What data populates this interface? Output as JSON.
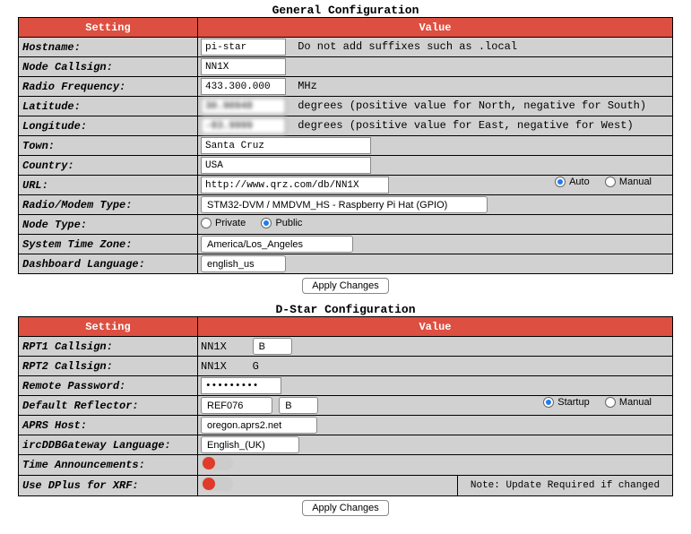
{
  "general": {
    "title": "General Configuration",
    "headers": {
      "setting": "Setting",
      "value": "Value"
    },
    "hostname": {
      "label": "Hostname:",
      "value": "pi-star",
      "hint": "Do not add suffixes such as .local"
    },
    "callsign": {
      "label": "Node Callsign:",
      "value": "NN1X"
    },
    "radiofreq": {
      "label": "Radio Frequency:",
      "value": "433.300.000",
      "hint": "MHz"
    },
    "latitude": {
      "label": "Latitude:",
      "value": "30.90948",
      "hint": "degrees (positive value for North, negative for South)"
    },
    "longitude": {
      "label": "Longitude:",
      "value": "-83.9999",
      "hint": "degrees (positive value for East, negative for West)"
    },
    "town": {
      "label": "Town:",
      "value": "Santa Cruz"
    },
    "country": {
      "label": "Country:",
      "value": "USA"
    },
    "url": {
      "label": "URL:",
      "value": "http://www.qrz.com/db/NN1X",
      "opts": {
        "auto": "Auto",
        "manual": "Manual",
        "selected": "auto"
      }
    },
    "modem": {
      "label": "Radio/Modem Type:",
      "value": "STM32-DVM / MMDVM_HS - Raspberry Pi Hat (GPIO)"
    },
    "nodetype": {
      "label": "Node Type:",
      "opts": {
        "private": "Private",
        "public": "Public",
        "selected": "public"
      }
    },
    "timezone": {
      "label": "System Time Zone:",
      "value": "America/Los_Angeles"
    },
    "dashlang": {
      "label": "Dashboard Language:",
      "value": "english_us"
    },
    "apply": "Apply Changes"
  },
  "dstar": {
    "title": "D-Star Configuration",
    "headers": {
      "setting": "Setting",
      "value": "Value"
    },
    "rpt1": {
      "label": "RPT1 Callsign:",
      "value": "NN1X",
      "module": "B"
    },
    "rpt2": {
      "label": "RPT2 Callsign:",
      "value": "NN1X",
      "suffix": "G"
    },
    "remotepw": {
      "label": "Remote Password:",
      "value": "•••••••••"
    },
    "reflector": {
      "label": "Default Reflector:",
      "name": "REF076",
      "module": "B",
      "opts": {
        "startup": "Startup",
        "manual": "Manual",
        "selected": "startup"
      }
    },
    "aprs": {
      "label": "APRS Host:",
      "value": "oregon.aprs2.net"
    },
    "irclang": {
      "label": "ircDDBGateway Language:",
      "value": "English_(UK)"
    },
    "timeann": {
      "label": "Time Announcements:"
    },
    "dplus": {
      "label": "Use DPlus for XRF:",
      "note": "Note: Update Required if changed"
    },
    "apply": "Apply Changes"
  }
}
